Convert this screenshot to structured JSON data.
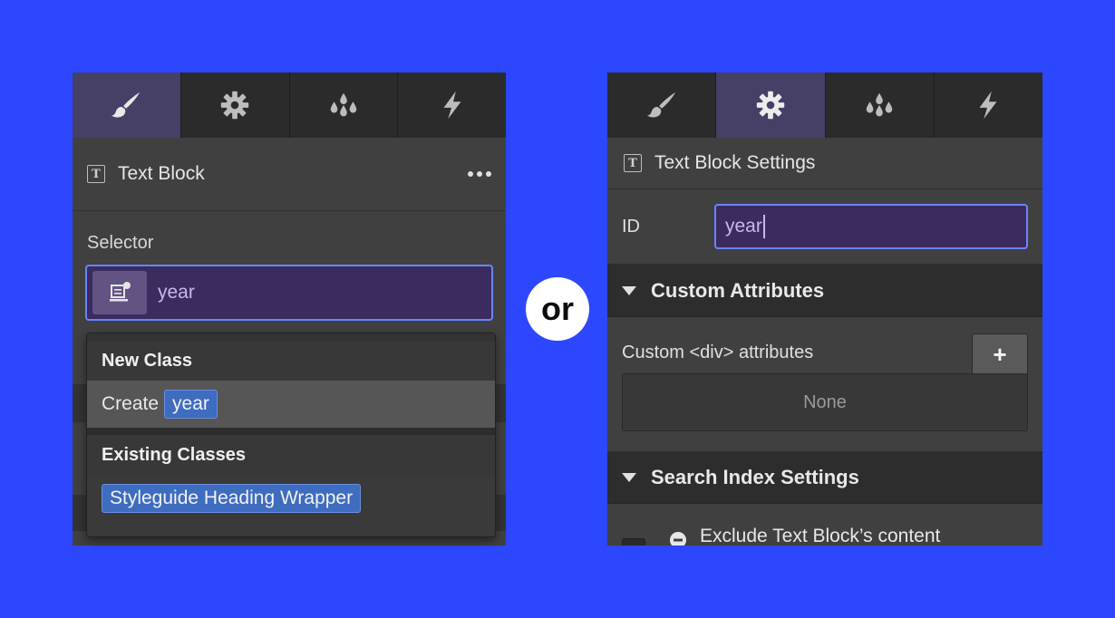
{
  "left": {
    "tabs": [
      {
        "name": "style",
        "icon": "brush-icon",
        "active": true
      },
      {
        "name": "settings",
        "icon": "gear-icon",
        "active": false
      },
      {
        "name": "style-manager",
        "icon": "drops-icon",
        "active": false
      },
      {
        "name": "interactions",
        "icon": "lightning-icon",
        "active": false
      }
    ],
    "header_title": "Text Block",
    "selector_label": "Selector",
    "selector_value": "year",
    "dropdown": {
      "new_class_heading": "New Class",
      "create_label": "Create",
      "create_chip": "year",
      "existing_heading": "Existing Classes",
      "existing_items": [
        "Styleguide Heading Wrapper"
      ]
    }
  },
  "or_label": "or",
  "right": {
    "tabs": [
      {
        "name": "style",
        "icon": "brush-icon",
        "active": false
      },
      {
        "name": "settings",
        "icon": "gear-icon",
        "active": true
      },
      {
        "name": "style-manager",
        "icon": "drops-icon",
        "active": false
      },
      {
        "name": "interactions",
        "icon": "lightning-icon",
        "active": false
      }
    ],
    "header_title": "Text Block Settings",
    "id_label": "ID",
    "id_value": "year",
    "custom_attributes_heading": "Custom Attributes",
    "custom_attr_label": "Custom <div> attributes",
    "add_button_label": "+",
    "none_label": "None",
    "search_index_heading": "Search Index Settings",
    "exclude_label": "Exclude Text Block’s content"
  },
  "colors": {
    "background": "#2c47fe",
    "panel": "#404040",
    "active_tab": "#463f66",
    "input_bg": "#3b2b5e",
    "focus_border": "#6b83ff",
    "chip": "#3e6cbf"
  }
}
